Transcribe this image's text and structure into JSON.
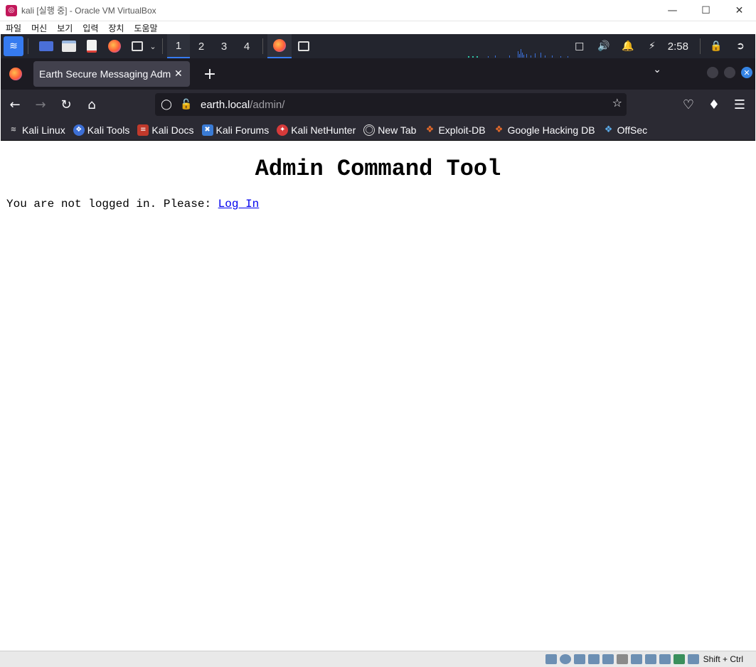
{
  "vbox": {
    "title": "kali [실행 중] - Oracle VM VirtualBox",
    "menu": [
      "파일",
      "머신",
      "보기",
      "입력",
      "장치",
      "도움말"
    ],
    "status_host_key": "Shift + Ctrl"
  },
  "kali_panel": {
    "workspaces": [
      "1",
      "2",
      "3",
      "4"
    ],
    "active_workspace": "1",
    "clock": "2:58",
    "accent": "#367bf0"
  },
  "firefox": {
    "tab_title": "Earth Secure Messaging Admin",
    "url_host": "earth.local",
    "url_path": "/admin/",
    "bookmarks": [
      {
        "label": "Kali Linux",
        "icon": "kali-dragon-icon"
      },
      {
        "label": "Kali Tools",
        "icon": "kali-tools-icon"
      },
      {
        "label": "Kali Docs",
        "icon": "kali-docs-icon"
      },
      {
        "label": "Kali Forums",
        "icon": "kali-forums-icon"
      },
      {
        "label": "Kali NetHunter",
        "icon": "nethunter-icon"
      },
      {
        "label": "New Tab",
        "icon": "globe-icon"
      },
      {
        "label": "Exploit-DB",
        "icon": "exploit-db-icon"
      },
      {
        "label": "Google Hacking DB",
        "icon": "ghdb-icon"
      },
      {
        "label": "OffSec",
        "icon": "offsec-icon"
      }
    ]
  },
  "page": {
    "heading": "Admin Command Tool",
    "message": "You are not logged in. Please: ",
    "login_link": "Log In"
  }
}
